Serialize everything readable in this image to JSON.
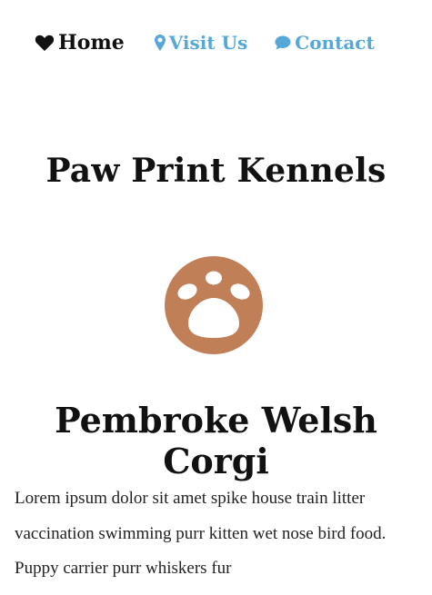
{
  "nav": {
    "home": {
      "label": "Home",
      "icon": "heart-icon"
    },
    "visit": {
      "label": "Visit Us",
      "icon": "map-pin-icon"
    },
    "contact": {
      "label": "Contact",
      "icon": "speech-bubble-icon"
    },
    "link_color": "#55a8d8"
  },
  "site": {
    "title": "Paw Print Kennels",
    "logo": {
      "icon": "paw-print-icon",
      "color": "#c17f58"
    }
  },
  "article": {
    "heading": "Pembroke Welsh Corgi",
    "body": "Lorem ipsum dolor sit amet spike house train litter vaccination swimming purr kitten wet nose bird food. Puppy carrier purr whiskers fur"
  }
}
